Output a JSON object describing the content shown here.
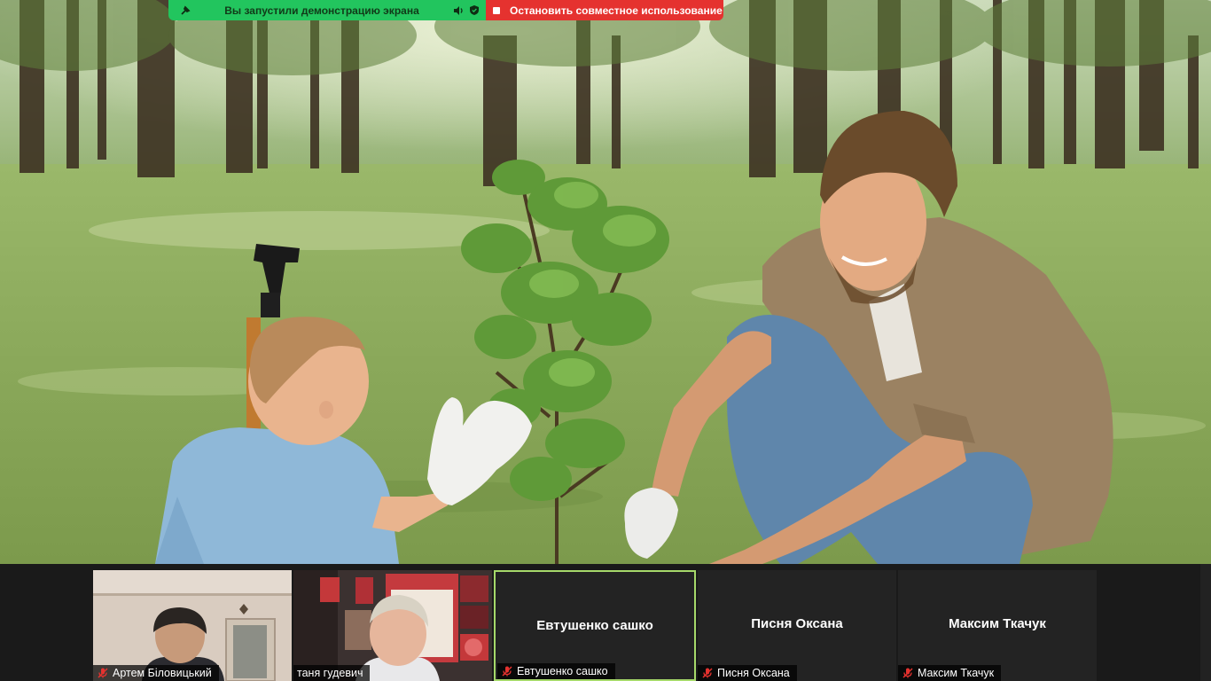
{
  "share_bar": {
    "status_text": "Вы запустили демонстрацию экрана",
    "stop_label": "Остановить совместное использование",
    "status_color": "#22c55e",
    "stop_color": "#e5322f",
    "icons": [
      "pin-icon",
      "speaker-icon",
      "shield-icon"
    ]
  },
  "shared_screen": {
    "content": "photo"
  },
  "participants": [
    {
      "name": "Артем Біловицький",
      "video": true,
      "muted": true
    },
    {
      "name": "таня гудевич",
      "video": true,
      "muted": false
    },
    {
      "name": "Евтушенко сашко",
      "center_name": "Евтушенко сашко",
      "video": false,
      "muted": true,
      "active_speaker": true
    },
    {
      "name": "Писня Оксана",
      "center_name": "Писня Оксана",
      "video": false,
      "muted": true
    },
    {
      "name": "Максим Ткачук",
      "center_name": "Максим Ткачук",
      "video": false,
      "muted": true
    }
  ],
  "colors": {
    "active_speaker_border": "#a6d96a",
    "muted_mic": "#e5322f",
    "strip_bg": "#1a1a1a"
  }
}
